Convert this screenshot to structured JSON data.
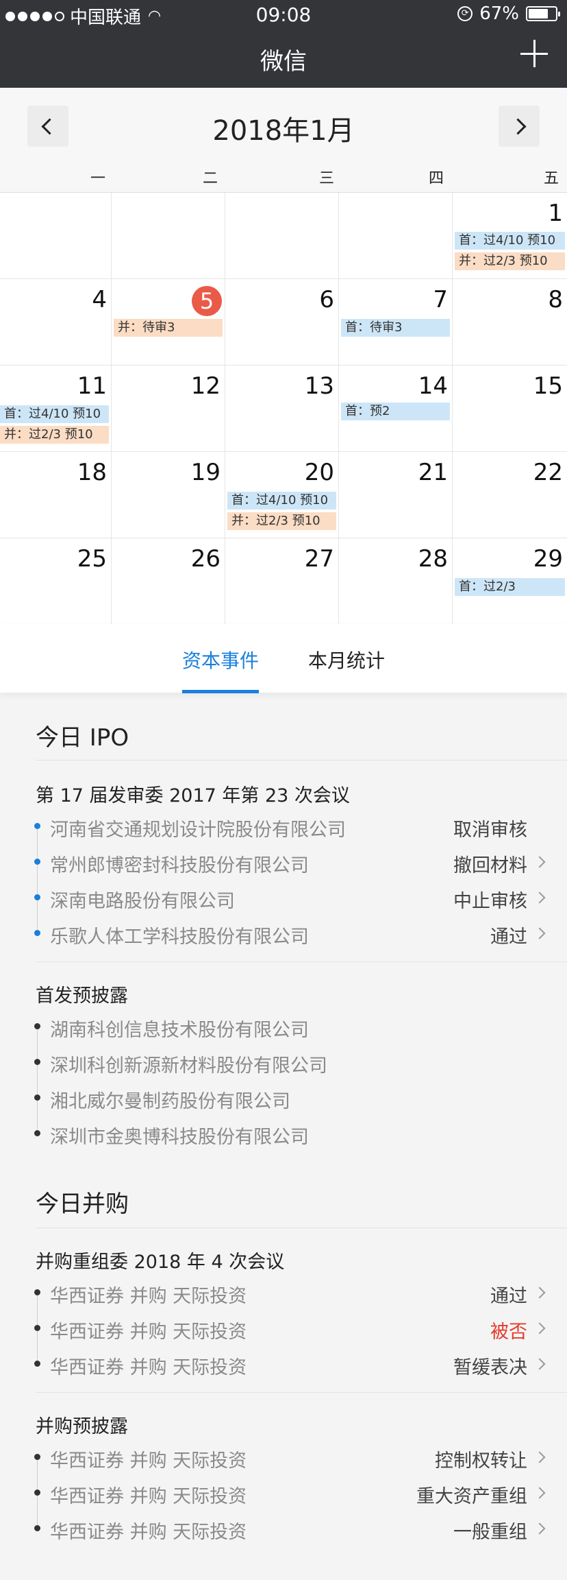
{
  "status_bar": {
    "carrier": "中国联通",
    "time": "09:08",
    "battery": "67%",
    "battery_level": 0.67
  },
  "nav": {
    "title": "微信"
  },
  "calendar": {
    "month_title": "2018年1月",
    "weekdays": [
      "一",
      "二",
      "三",
      "四",
      "五"
    ],
    "days": [
      "1",
      "4",
      "5",
      "6",
      "7",
      "8",
      "11",
      "12",
      "13",
      "14",
      "15",
      "18",
      "19",
      "20",
      "21",
      "22",
      "25",
      "26",
      "27",
      "28",
      "29"
    ],
    "tags": {
      "t1a": "首：过4/10 预10",
      "t1b": "并：过2/3 预10",
      "t5": "并：待审3",
      "t7": "首：待审3",
      "t11a": "首：过4/10 预10",
      "t11b": "并：过2/3 预10",
      "t14": "首：预2",
      "t20a": "首：过4/10 预10",
      "t20b": "并：过2/3 预10",
      "t29": "首：过2/3"
    }
  },
  "tabs": {
    "events": "资本事件",
    "stats": "本月统计"
  },
  "ipo": {
    "title": "今日 IPO",
    "meeting_title": "第 17 届发审委 2017 年第 23 次会议",
    "meeting_items": [
      {
        "name": "河南省交通规划设计院股份有限公司",
        "status": "取消审核"
      },
      {
        "name": "常州郎博密封科技股份有限公司",
        "status": "撤回材料"
      },
      {
        "name": "深南电路股份有限公司",
        "status": "中止审核"
      },
      {
        "name": "乐歌人体工学科技股份有限公司",
        "status": "通过"
      }
    ],
    "pre_title": "首发预披露",
    "pre_items": [
      {
        "name": "湖南科创信息技术股份有限公司"
      },
      {
        "name": "深圳科创新源新材料股份有限公司"
      },
      {
        "name": "湘北威尔曼制药股份有限公司"
      },
      {
        "name": "深圳市金奥博科技股份有限公司"
      }
    ]
  },
  "mna": {
    "title": "今日并购",
    "meeting_title": "并购重组委 2018 年 4 次会议",
    "meeting_items": [
      {
        "name": "华西证券  并购  天际投资",
        "status": "通过"
      },
      {
        "name": "华西证券  并购  天际投资",
        "status": "被否"
      },
      {
        "name": "华西证券  并购  天际投资",
        "status": "暂缓表决"
      }
    ],
    "pre_title": "并购预披露",
    "pre_items": [
      {
        "name": "华西证券  并购  天际投资",
        "status": "控制权转让"
      },
      {
        "name": "华西证券  并购  天际投资",
        "status": "重大资产重组"
      },
      {
        "name": "华西证券  并购  天际投资",
        "status": "一般重组"
      }
    ]
  },
  "colors": {
    "accent": "#1a7fdc",
    "nav_bg": "#343539",
    "today": "#ea5a48",
    "rejected": "#e43b2c"
  }
}
